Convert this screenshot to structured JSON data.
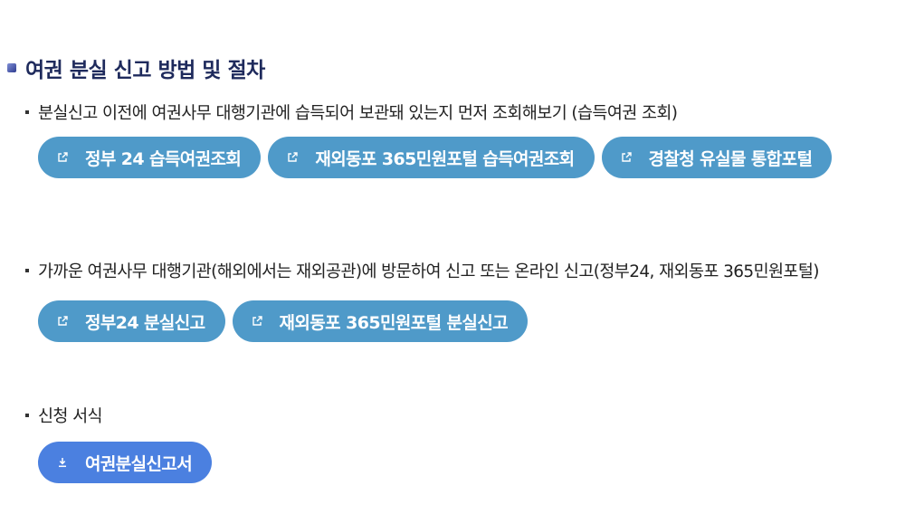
{
  "page": {
    "title": "여권 분실 신고 방법 및 절차"
  },
  "sections": [
    {
      "text": "분실신고 이전에 여권사무 대행기관에 습득되어 보관돼 있는지 먼저 조회해보기 (습득여권 조회)",
      "buttons": [
        {
          "label": "정부 24 습득여권조회",
          "icon": "external-link-icon"
        },
        {
          "label": "재외동포 365민원포털 습득여권조회",
          "icon": "external-link-icon"
        },
        {
          "label": "경찰청 유실물 통합포털",
          "icon": "external-link-icon"
        }
      ]
    },
    {
      "text": "가까운 여권사무 대행기관(해외에서는 재외공관)에 방문하여 신고 또는 온라인 신고(정부24, 재외동포 365민원포털)",
      "buttons": [
        {
          "label": "정부24 분실신고",
          "icon": "external-link-icon"
        },
        {
          "label": "재외동포 365민원포털 분실신고",
          "icon": "external-link-icon"
        }
      ]
    },
    {
      "text": "신청 서식",
      "buttons": [
        {
          "label": "여권분실신고서",
          "icon": "download-icon"
        }
      ]
    }
  ],
  "colors": {
    "title": "#1e2a5c",
    "link_button": "#4f9ac9",
    "download_button": "#4b80e0"
  }
}
